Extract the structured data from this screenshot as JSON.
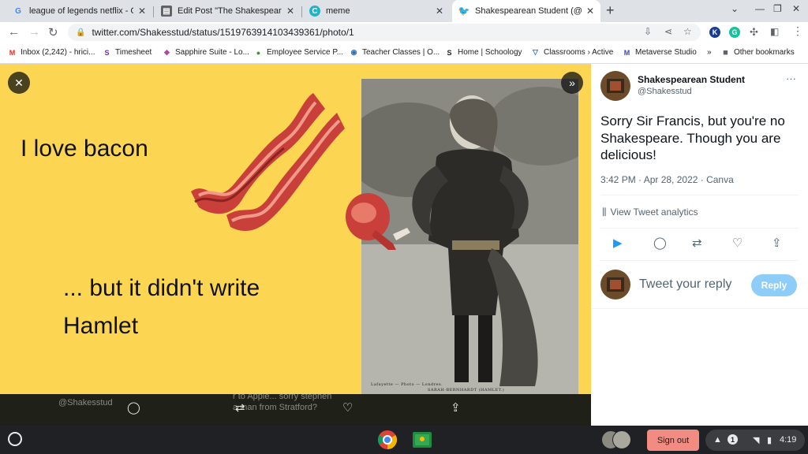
{
  "tabs": [
    {
      "label": "league of legends netflix - Googl",
      "icon": "google-icon"
    },
    {
      "label": "Edit Post \"The Shakespeare Auth",
      "icon": "blog-icon"
    },
    {
      "label": "meme",
      "icon": "canva-icon"
    },
    {
      "label": "Shakespearean Student (@Shake",
      "icon": "twitter-icon",
      "active": true
    }
  ],
  "address": {
    "url": "twitter.com/Shakesstud/status/1519763914103439361/photo/1"
  },
  "extensions": {
    "k": "K",
    "g": "G"
  },
  "bookmarks": [
    {
      "label": "Inbox (2,242) - hrici...",
      "icon": "M",
      "color": "#d93025"
    },
    {
      "label": "Timesheet",
      "icon": "S",
      "color": "#6b2fa6"
    },
    {
      "label": "Sapphire Suite - Lo...",
      "icon": "◆",
      "color": "#a64ca6"
    },
    {
      "label": "Employee Service P...",
      "icon": "●",
      "color": "#4e8a3a"
    },
    {
      "label": "Teacher Classes | O...",
      "icon": "◉",
      "color": "#2f6fba"
    },
    {
      "label": "Home | Schoology",
      "icon": "S",
      "color": "#202124"
    },
    {
      "label": "Classrooms › Active",
      "icon": "▽",
      "color": "#1a73e8"
    },
    {
      "label": "Metaverse Studio",
      "icon": "M",
      "color": "#3949ab"
    }
  ],
  "bookmarks_more": "»",
  "other_bookmarks": "Other bookmarks",
  "slide": {
    "line1": "I love bacon",
    "line2": "... but it didn't write",
    "line3": "Hamlet",
    "photo_caption_small": "Lafayette — Photo — Londres.",
    "photo_caption": "SARAH-BERNHARDT (HAMLET.)",
    "bg_color": "#fcd653"
  },
  "underlay": {
    "handle": "@Shakesstud",
    "text1": "r to Apple...  sorry stephen",
    "text2": "a man from Stratford?"
  },
  "tweet": {
    "author": "Shakespearean Student",
    "handle": "@Shakesstud",
    "more": "···",
    "text": "Sorry Sir Francis, but you're no Shakespeare. Though you are delicious!",
    "meta": "3:42 PM · Apr 28, 2022 · Canva",
    "analytics": "View Tweet analytics",
    "reply_placeholder": "Tweet your reply",
    "reply_button": "Reply"
  },
  "shelf": {
    "signout": "Sign out",
    "notif_count": "1",
    "time": "4:19"
  }
}
